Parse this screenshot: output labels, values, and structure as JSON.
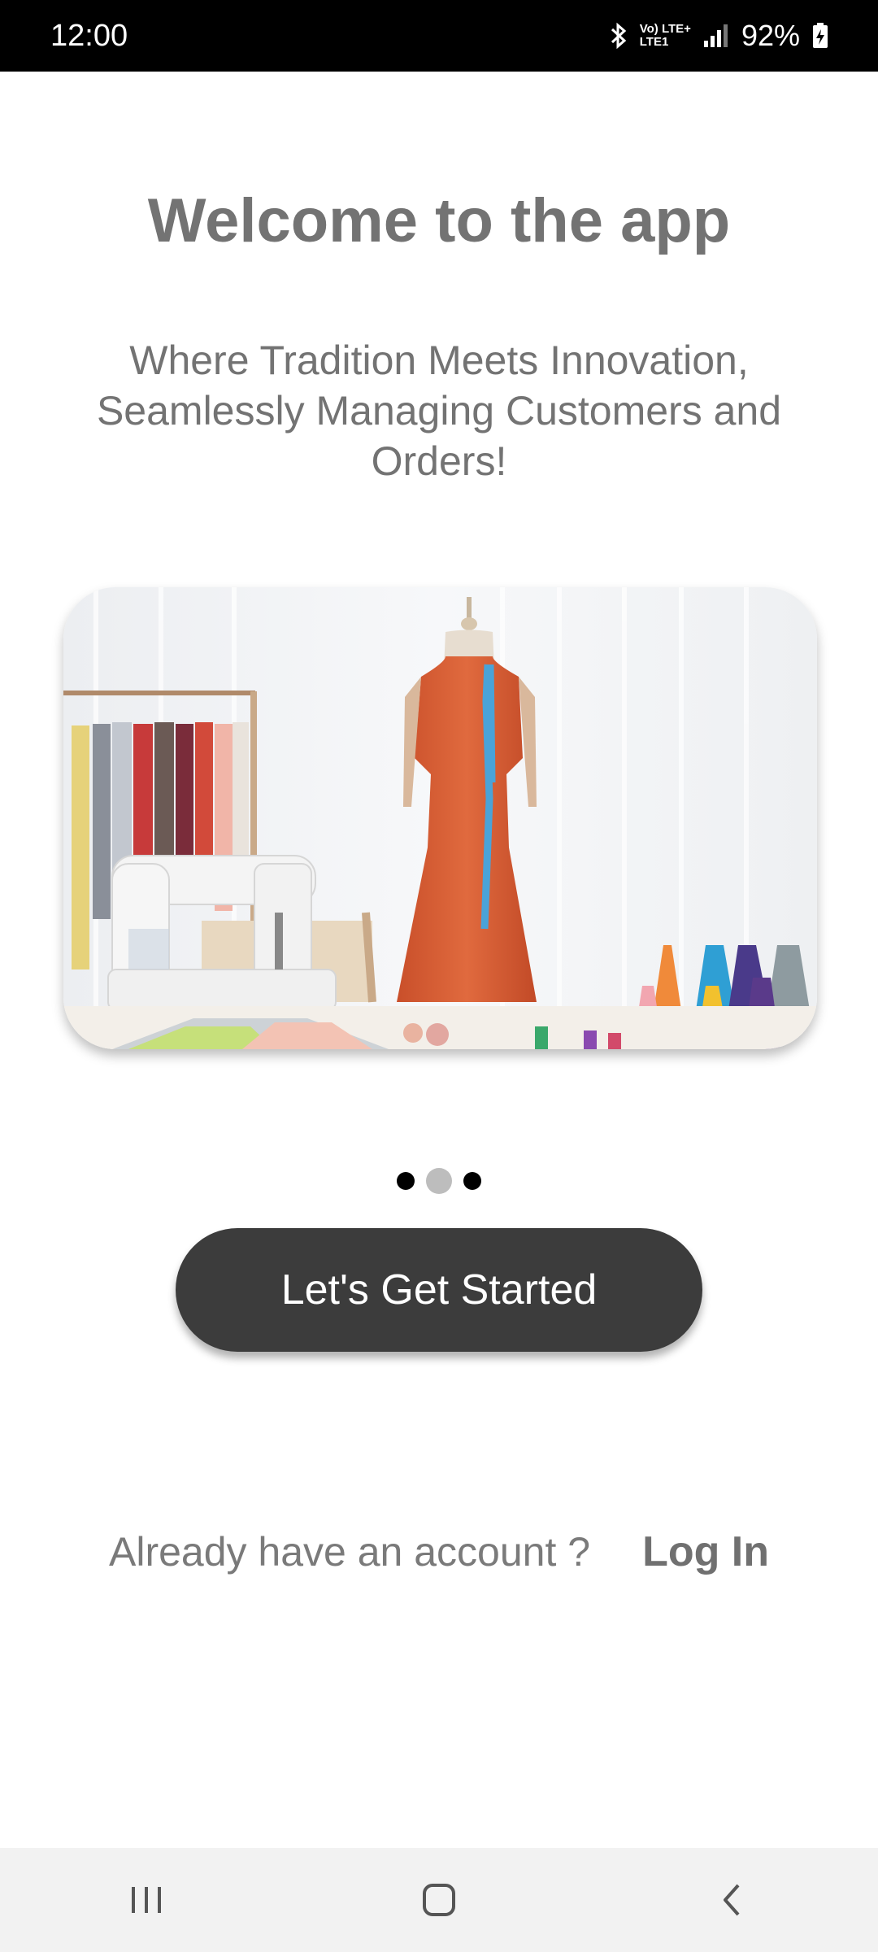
{
  "status_bar": {
    "time": "12:00",
    "network_top": "Vo) LTE+",
    "network_bottom": "LTE1",
    "battery": "92%",
    "icons": [
      "bluetooth-icon",
      "signal-icon",
      "battery-charging-icon"
    ]
  },
  "welcome": {
    "title": "Welcome to the app",
    "subtitle": "Where Tradition Meets Innovation, Seamlessly Managing Customers and Orders!"
  },
  "hero_image": {
    "subject": "tailoring studio with dress form in orange dress, sewing machine, clothes rack and thread spools"
  },
  "pager": {
    "count": 3,
    "active_index": 1
  },
  "cta": {
    "label": "Let's Get Started"
  },
  "login": {
    "question": "Already have an account ?",
    "link": "Log In"
  },
  "nav_bar": {
    "icons": [
      "recents-icon",
      "home-icon",
      "back-icon"
    ]
  }
}
